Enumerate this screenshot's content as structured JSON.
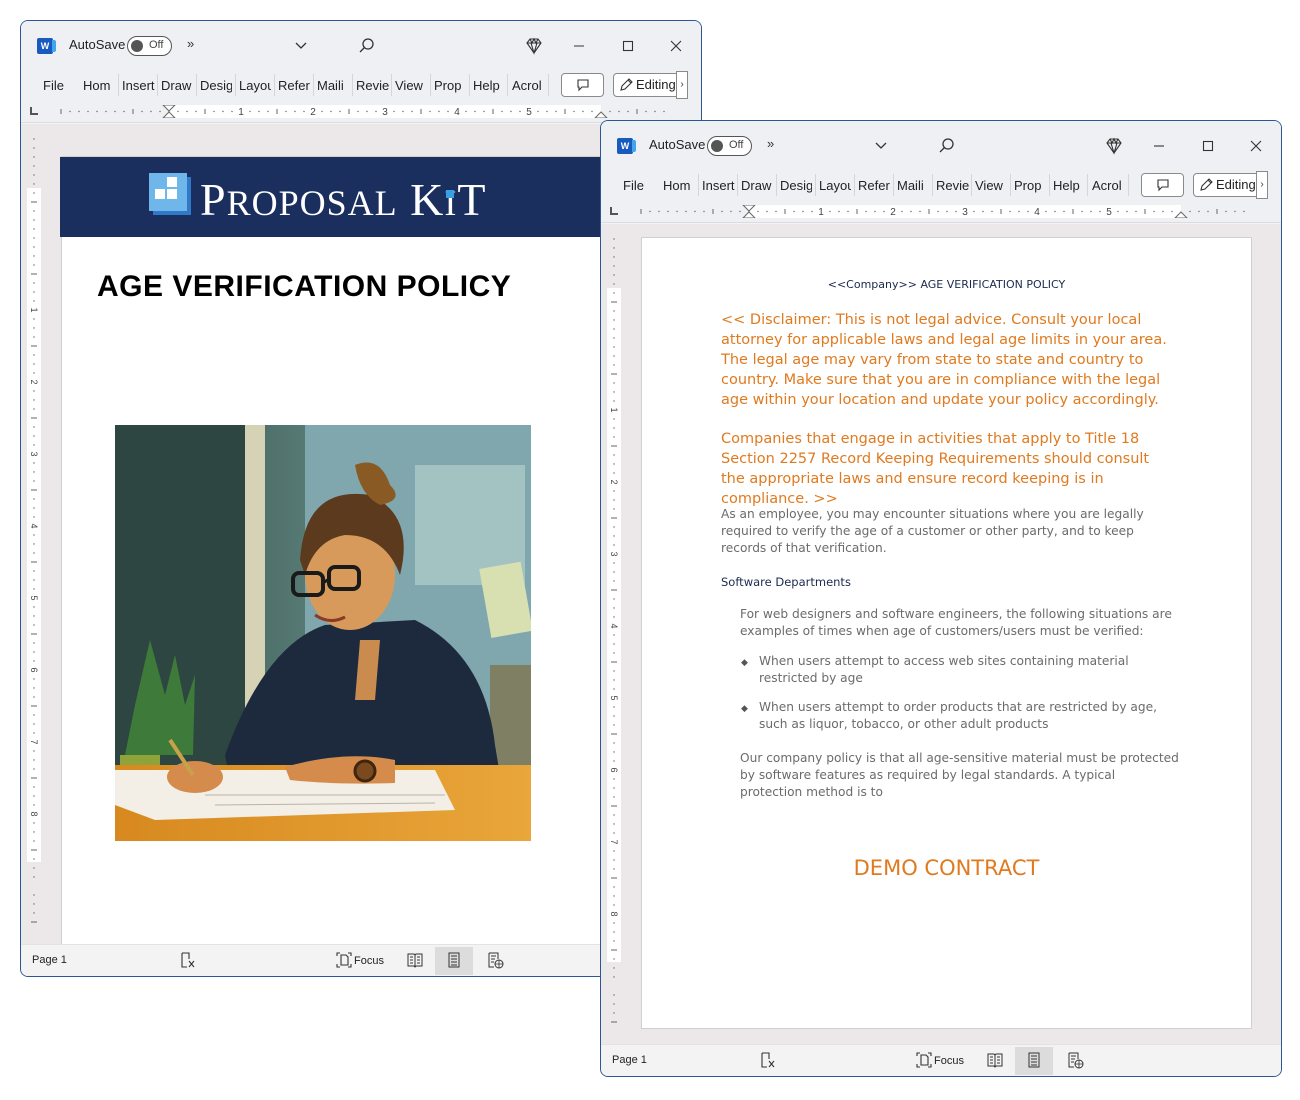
{
  "windows": {
    "back": {
      "app_icon_letter": "W",
      "autosave_label": "AutoSave",
      "autosave_state": "Off",
      "more_glyph": "»",
      "dropdown_glyph": "⌄",
      "tabs": [
        "File",
        "Home",
        "Insert",
        "Draw",
        "Design",
        "Layout",
        "References",
        "Mailings",
        "Review",
        "View",
        "Properties",
        "Help",
        "Acrobat"
      ],
      "tabs_visible": [
        "File",
        "Hom",
        "Insert",
        "Draw",
        "Desig",
        "Layou",
        "Refer",
        "Maili",
        "Revie",
        "View",
        "Prop",
        "Help",
        "Acrol"
      ],
      "editing_label": "Editing",
      "ruler_numbers": [
        "1",
        "2",
        "3",
        "4",
        "5"
      ],
      "vruler_numbers": [
        "1",
        "2",
        "3",
        "4",
        "5",
        "6",
        "7",
        "8"
      ],
      "cover": {
        "brand_name": "PROPOSAL KIT",
        "brand_first": "P",
        "brand_rest1": "ROPOSAL",
        "brand_k": "K",
        "brand_i": "I",
        "brand_t": "T",
        "title": "AGE VERIFICATION POLICY",
        "image_alt": "Illustration of a woman with glasses writing on documents at a desk"
      },
      "status": {
        "page": "Page 1",
        "focus_label": "Focus"
      }
    },
    "front": {
      "app_icon_letter": "W",
      "autosave_label": "AutoSave",
      "autosave_state": "Off",
      "more_glyph": "»",
      "dropdown_glyph": "⌄",
      "tabs_visible": [
        "File",
        "Hom",
        "Insert",
        "Draw",
        "Desig",
        "Layou",
        "Refer",
        "Maili",
        "Revie",
        "View",
        "Prop",
        "Help",
        "Acrol"
      ],
      "editing_label": "Editing",
      "ruler_numbers": [
        "1",
        "2",
        "3",
        "4",
        "5"
      ],
      "vruler_numbers": [
        "1",
        "2",
        "3",
        "4",
        "5",
        "6",
        "7",
        "8"
      ],
      "document": {
        "header": "<<Company>> AGE VERIFICATION POLICY",
        "disclaimer_1": "<< Disclaimer: This is not legal advice. Consult your local attorney for applicable laws and legal age limits in your area. The legal age may vary from state to state and country to country. Make sure that you are in compliance with the legal age within your location and update your policy accordingly.",
        "disclaimer_2": "Companies that engage in activities that apply to Title 18 Section 2257 Record Keeping Requirements should consult the appropriate laws and ensure record keeping is in compliance. >>",
        "intro": "As an employee, you may encounter situations where you are legally required to verify the age of a customer or other party, and to keep records of that verification.",
        "section_heading": "Software Departments",
        "section_intro": "For web designers and software engineers, the following situations are examples of times when age of customers/users must be verified:",
        "bullets": [
          "When users attempt to access web sites containing material restricted by age",
          "When users attempt to order products that are restricted by age, such as liquor, tobacco, or other adult products"
        ],
        "policy_text": "Our company policy is that all age-sensitive material must be protected by software features as required by legal standards. A typical protection method is to",
        "watermark": "DEMO CONTRACT"
      },
      "status": {
        "page": "Page 1",
        "focus_label": "Focus"
      }
    }
  },
  "colors": {
    "word_blue": "#185abd",
    "banner_navy": "#1b2f5e",
    "disclaimer_orange": "#e07a1f",
    "heading_navy": "#1b2a4e",
    "body_gray": "#6b6b6b"
  }
}
